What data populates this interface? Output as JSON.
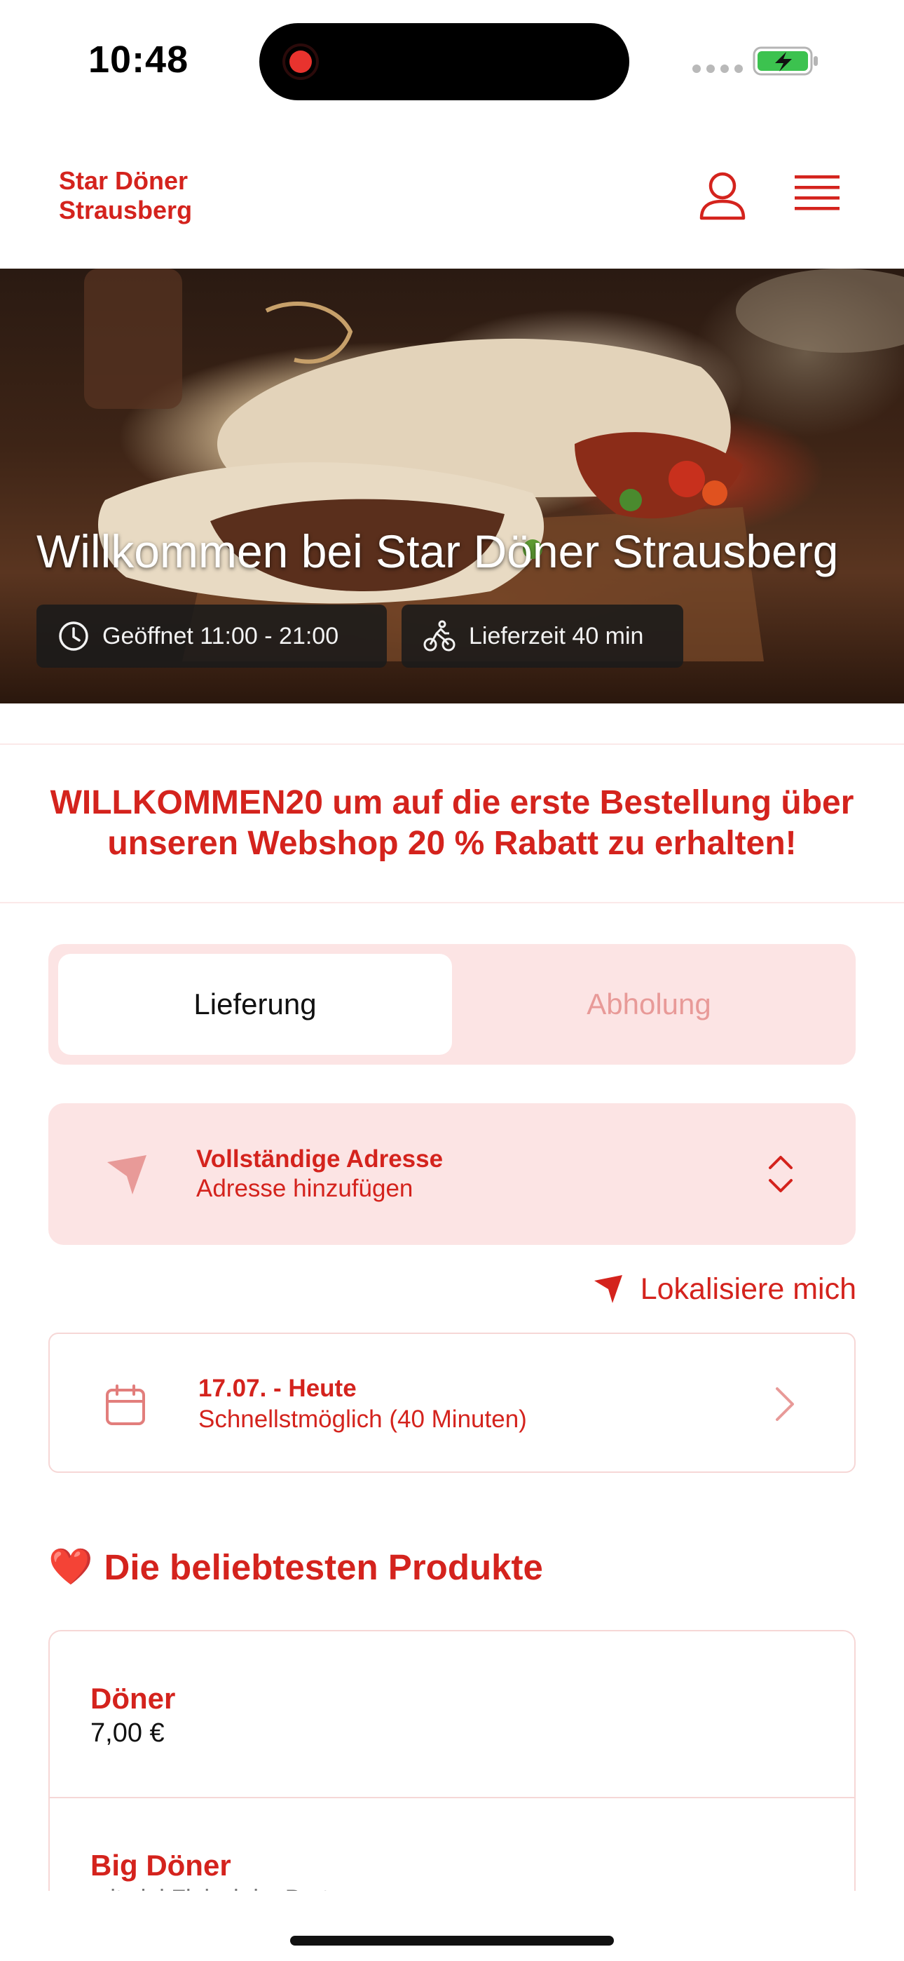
{
  "status_bar": {
    "time": "10:48"
  },
  "header": {
    "brand_line1": "Star Döner",
    "brand_line2": "Strausberg",
    "user_icon": "user-icon",
    "menu_icon": "hamburger-menu-icon"
  },
  "hero": {
    "title": "Willkommen bei Star Döner Strausberg",
    "opening_hours": "Geöffnet 11:00 - 21:00",
    "delivery_time": "Lieferzeit 40 min"
  },
  "promo": {
    "line1": "WILLKOMMEN20 um auf die erste Bestellung über",
    "line2": "unseren Webshop 20 % Rabatt zu erhalten!"
  },
  "order_mode": {
    "options": [
      "Lieferung",
      "Abholung"
    ],
    "selected": "Lieferung"
  },
  "address": {
    "title": "Vollständige Adresse",
    "subtitle": "Adresse hinzufügen"
  },
  "locate_label": "Lokalisiere mich",
  "schedule": {
    "date": "17.07. - Heute",
    "time": "Schnellstmöglich (40 Minuten)"
  },
  "popular": {
    "heading_emoji": "❤️",
    "heading": "Die beliebtesten Produkte",
    "products": [
      {
        "name": "Döner",
        "price": "7,00 €"
      },
      {
        "name": "Big Döner",
        "desc": "mit viel Fleisch im Brot"
      }
    ]
  },
  "colors": {
    "brand_red": "#d4231d",
    "light_pink": "#fce4e4",
    "muted_red": "#e89a98"
  }
}
